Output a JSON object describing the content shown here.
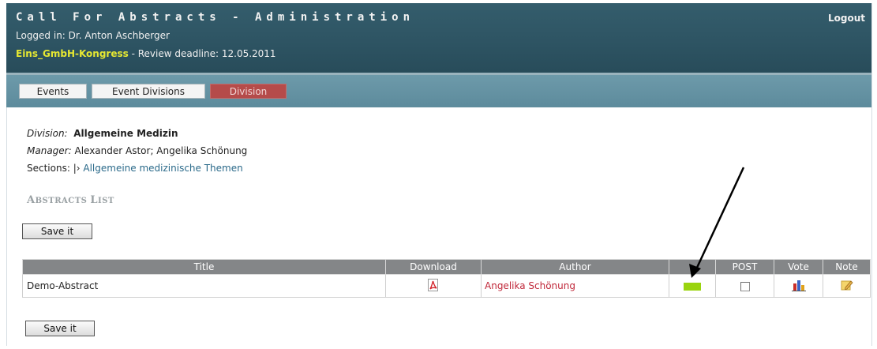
{
  "header": {
    "title": "Call For Abstracts - Administration",
    "logged_in": "Logged in: Dr. Anton Aschberger",
    "event_name": "Eins_GmbH-Kongress",
    "review_deadline": " - Review deadline: 12.05.2011",
    "logout": "Logout"
  },
  "tabs": [
    {
      "label": "Events",
      "active": false
    },
    {
      "label": "Event Divisions",
      "active": false
    },
    {
      "label": "Division",
      "active": true
    }
  ],
  "division": {
    "division_label": "Division:",
    "division_value": "Allgemeine Medizin",
    "manager_label": "Manager:",
    "manager_value": "Alexander Astor; Angelika Schönung",
    "sections_label": "Sections:",
    "sections_sep": "|›",
    "sections_link": "Allgemeine medizinische Themen"
  },
  "abstracts": {
    "heading_a": "A",
    "heading_b": "BSTRACTS ",
    "heading_c": "L",
    "heading_d": "IST",
    "save_label": "Save it",
    "columns": [
      "Title",
      "Download",
      "Author",
      "",
      "POST",
      "Vote",
      "Note"
    ],
    "rows": [
      {
        "title": "Demo-Abstract",
        "download_icon": "pdf-icon",
        "author": "Angelika Schönung",
        "status_color": "#9ad40f",
        "post_checked": false,
        "vote_icon": "vote-icon",
        "note_icon": "note-edit-icon"
      }
    ]
  },
  "colors": {
    "header_bg": "#2f5665",
    "tabbar_bg": "#5d8b9c",
    "active_tab": "#b54b4a",
    "event_name": "#e6e832",
    "table_header": "#848688",
    "author": "#c0283a",
    "status_green": "#9ad40f"
  }
}
